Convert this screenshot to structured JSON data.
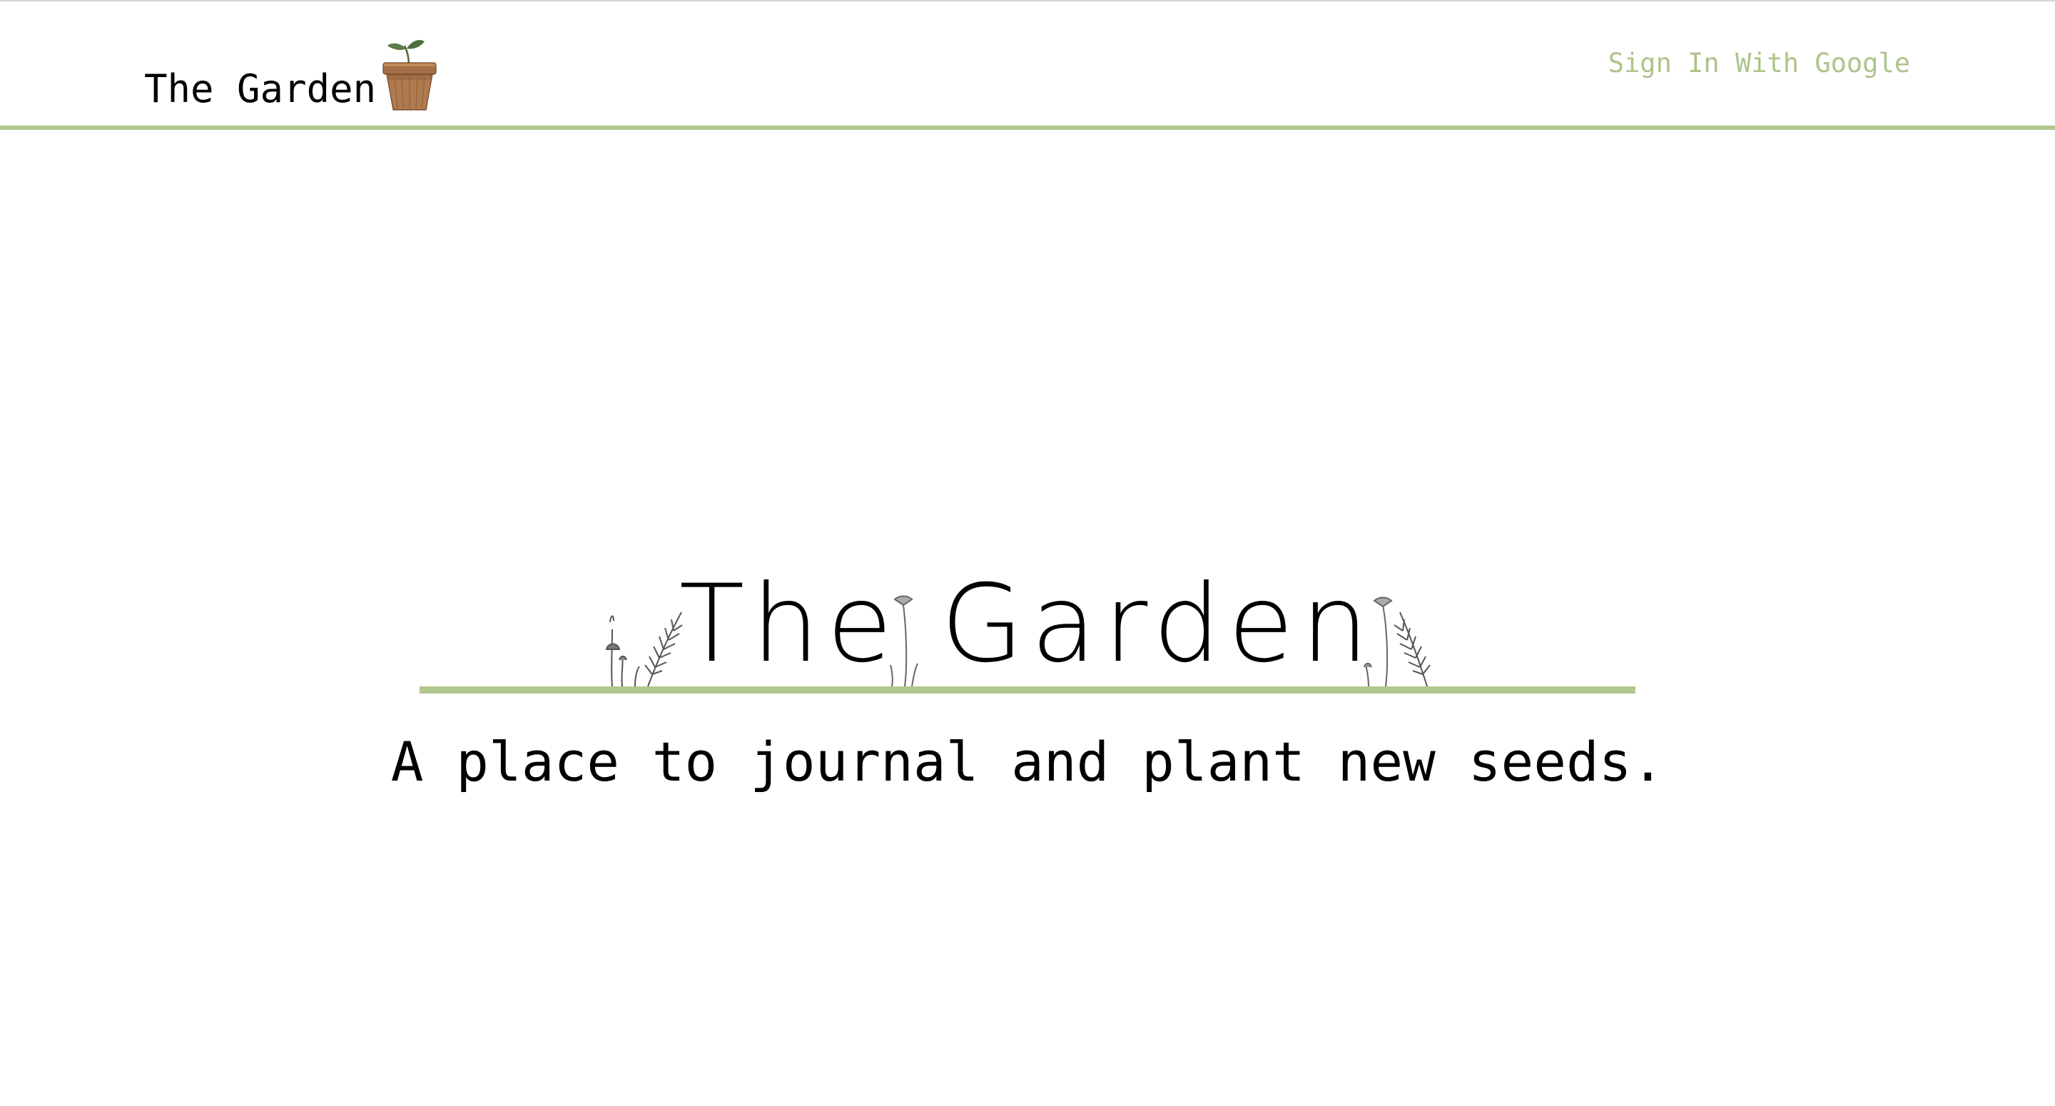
{
  "header": {
    "brand_label": "The Garden",
    "signin_label": "Sign In With Google"
  },
  "hero": {
    "title": "The Garden",
    "tagline": "A place to journal and plant new seeds."
  },
  "colors": {
    "accent": "#b2c78d",
    "signin_text": "#adc48b",
    "pot": "#b07a4f",
    "leaf": "#5d7a4a"
  },
  "icons": {
    "brand": "plant-pot-icon",
    "decorations": [
      "mushroom-icon",
      "fern-icon",
      "dandelion-icon",
      "dandelion-icon",
      "fern-icon"
    ]
  }
}
